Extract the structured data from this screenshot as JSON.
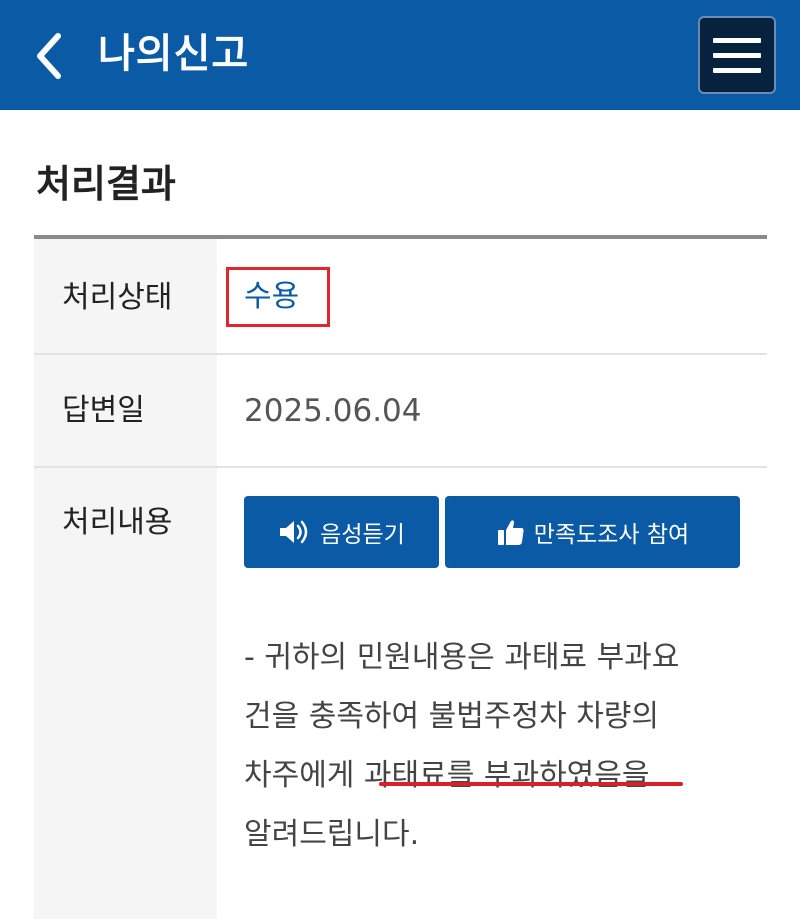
{
  "header": {
    "title": "나의신고",
    "back_icon": "chevron-left-icon",
    "menu_icon": "hamburger-menu-icon",
    "background_color": "#0a5aa6"
  },
  "section": {
    "title": "처리결과"
  },
  "table": {
    "status": {
      "label": "처리상태",
      "value": "수용",
      "value_color": "#0a5aa6",
      "highlight_color": "#e0262e"
    },
    "answer_date": {
      "label": "답변일",
      "value": "2025.06.04"
    },
    "content": {
      "label": "처리내용",
      "buttons": {
        "listen": {
          "label": "음성듣기",
          "icon": "speaker-icon"
        },
        "survey": {
          "label": "만족도조사 참여",
          "icon": "thumbs-up-icon"
        }
      },
      "text_lines": [
        "- 귀하의 민원내용은 과태료 부과요",
        "건을 충족하여 불법주정차 차량의",
        "차주에게 과태료를 부과하였음을",
        "알려드립니다."
      ]
    }
  }
}
